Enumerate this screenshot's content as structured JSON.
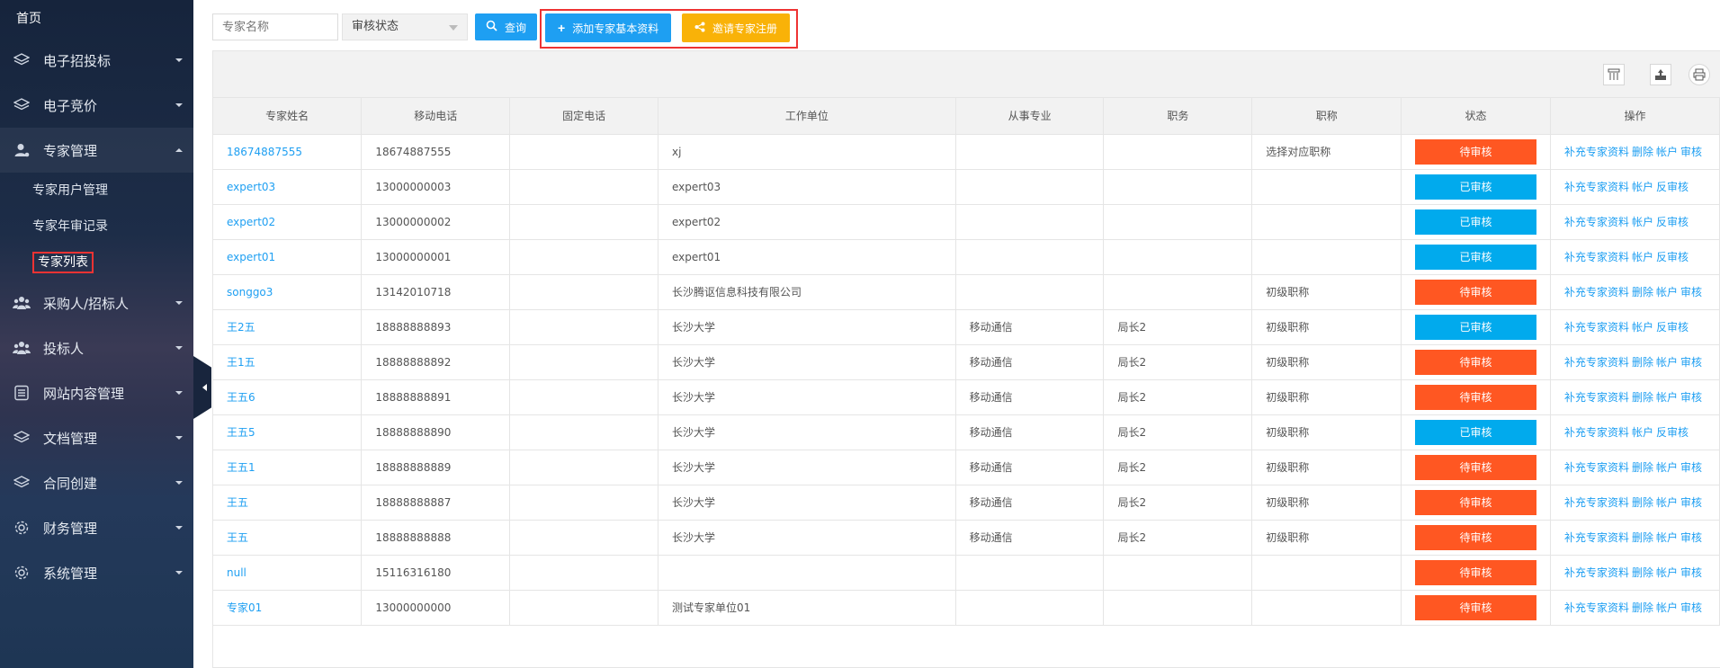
{
  "sidebar": {
    "home": "首页",
    "items": [
      {
        "label": "电子招投标",
        "icon": "layers-icon"
      },
      {
        "label": "电子竞价",
        "icon": "layers-icon"
      },
      {
        "label": "专家管理",
        "icon": "user-icon"
      },
      {
        "label": "采购人/招标人",
        "icon": "group-icon"
      },
      {
        "label": "投标人",
        "icon": "group-icon"
      },
      {
        "label": "网站内容管理",
        "icon": "document-icon"
      },
      {
        "label": "文档管理",
        "icon": "layers-icon"
      },
      {
        "label": "合同创建",
        "icon": "layers-icon"
      },
      {
        "label": "财务管理",
        "icon": "gear-icon"
      },
      {
        "label": "系统管理",
        "icon": "gear-icon"
      }
    ],
    "sub_items": [
      "专家用户管理",
      "专家年审记录",
      "专家列表"
    ]
  },
  "toolbar": {
    "name_placeholder": "专家名称",
    "status_select": "审核状态",
    "query_label": "查询",
    "add_label": "添加专家基本资料",
    "invite_label": "邀请专家注册"
  },
  "table": {
    "headers": [
      "专家姓名",
      "移动电话",
      "固定电话",
      "工作单位",
      "从事专业",
      "职务",
      "职称",
      "状态",
      "操作"
    ],
    "rows": [
      {
        "name": "18674887555",
        "mobile": "18674887555",
        "phone": "",
        "unit": "xj",
        "major": "",
        "post": "",
        "title": "选择对应职称",
        "status": "待审核",
        "ops": [
          "补充专家资料",
          "删除",
          "帐户",
          "审核"
        ]
      },
      {
        "name": "expert03",
        "mobile": "13000000003",
        "phone": "",
        "unit": "expert03",
        "major": "",
        "post": "",
        "title": "",
        "status": "已审核",
        "ops": [
          "补充专家资料",
          "帐户",
          "反审核"
        ]
      },
      {
        "name": "expert02",
        "mobile": "13000000002",
        "phone": "",
        "unit": "expert02",
        "major": "",
        "post": "",
        "title": "",
        "status": "已审核",
        "ops": [
          "补充专家资料",
          "帐户",
          "反审核"
        ]
      },
      {
        "name": "expert01",
        "mobile": "13000000001",
        "phone": "",
        "unit": "expert01",
        "major": "",
        "post": "",
        "title": "",
        "status": "已审核",
        "ops": [
          "补充专家资料",
          "帐户",
          "反审核"
        ]
      },
      {
        "name": "songgo3",
        "mobile": "13142010718",
        "phone": "",
        "unit": "长沙腾讴信息科技有限公司",
        "major": "",
        "post": "",
        "title": "初级职称",
        "status": "待审核",
        "ops": [
          "补充专家资料",
          "删除",
          "帐户",
          "审核"
        ]
      },
      {
        "name": "王2五",
        "mobile": "18888888893",
        "phone": "",
        "unit": "长沙大学",
        "major": "移动通信",
        "post": "局长2",
        "title": "初级职称",
        "status": "已审核",
        "ops": [
          "补充专家资料",
          "帐户",
          "反审核"
        ]
      },
      {
        "name": "王1五",
        "mobile": "18888888892",
        "phone": "",
        "unit": "长沙大学",
        "major": "移动通信",
        "post": "局长2",
        "title": "初级职称",
        "status": "待审核",
        "ops": [
          "补充专家资料",
          "删除",
          "帐户",
          "审核"
        ]
      },
      {
        "name": "王五6",
        "mobile": "18888888891",
        "phone": "",
        "unit": "长沙大学",
        "major": "移动通信",
        "post": "局长2",
        "title": "初级职称",
        "status": "待审核",
        "ops": [
          "补充专家资料",
          "删除",
          "帐户",
          "审核"
        ]
      },
      {
        "name": "王五5",
        "mobile": "18888888890",
        "phone": "",
        "unit": "长沙大学",
        "major": "移动通信",
        "post": "局长2",
        "title": "初级职称",
        "status": "已审核",
        "ops": [
          "补充专家资料",
          "帐户",
          "反审核"
        ]
      },
      {
        "name": "王五1",
        "mobile": "18888888889",
        "phone": "",
        "unit": "长沙大学",
        "major": "移动通信",
        "post": "局长2",
        "title": "初级职称",
        "status": "待审核",
        "ops": [
          "补充专家资料",
          "删除",
          "帐户",
          "审核"
        ]
      },
      {
        "name": "王五",
        "mobile": "18888888887",
        "phone": "",
        "unit": "长沙大学",
        "major": "移动通信",
        "post": "局长2",
        "title": "初级职称",
        "status": "待审核",
        "ops": [
          "补充专家资料",
          "删除",
          "帐户",
          "审核"
        ]
      },
      {
        "name": "王五",
        "mobile": "18888888888",
        "phone": "",
        "unit": "长沙大学",
        "major": "移动通信",
        "post": "局长2",
        "title": "初级职称",
        "status": "待审核",
        "ops": [
          "补充专家资料",
          "删除",
          "帐户",
          "审核"
        ]
      },
      {
        "name": "null",
        "mobile": "15116316180",
        "phone": "",
        "unit": "",
        "major": "",
        "post": "",
        "title": "",
        "status": "待审核",
        "ops": [
          "补充专家资料",
          "删除",
          "帐户",
          "审核"
        ]
      },
      {
        "name": "专家01",
        "mobile": "13000000000",
        "phone": "",
        "unit": "测试专家单位01",
        "major": "",
        "post": "",
        "title": "",
        "status": "待审核",
        "ops": [
          "补充专家资料",
          "删除",
          "帐户",
          "审核"
        ]
      }
    ]
  },
  "colors": {
    "pending": "#ff5722",
    "approved": "#01aaed",
    "link": "#1e9ff2",
    "invite": "#f9b208"
  }
}
